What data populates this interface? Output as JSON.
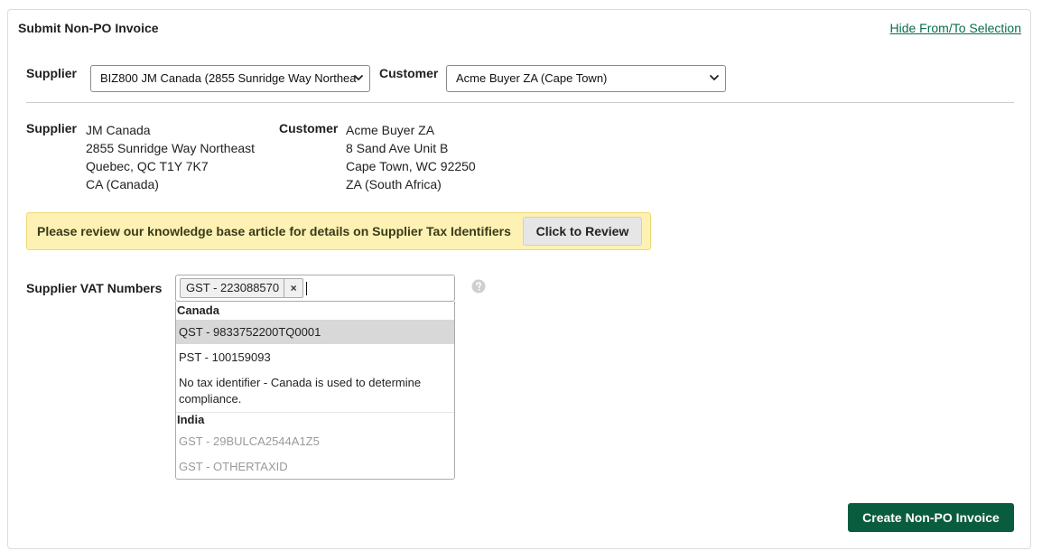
{
  "header": {
    "title": "Submit Non-PO Invoice",
    "hide_link": "Hide From/To Selection"
  },
  "selection": {
    "supplier_label": "Supplier",
    "supplier_value": "BIZ800 JM Canada (2855 Sunridge Way Northea",
    "customer_label": "Customer",
    "customer_value": "Acme Buyer ZA (Cape Town)"
  },
  "addresses": {
    "supplier": {
      "label": "Supplier",
      "lines": [
        "JM Canada",
        "2855 Sunridge Way Northeast",
        "Quebec, QC T1Y 7K7",
        "CA (Canada)"
      ]
    },
    "customer": {
      "label": "Customer",
      "lines": [
        "Acme Buyer ZA",
        "8 Sand Ave Unit B",
        "Cape Town, WC 92250",
        "ZA (South Africa)"
      ]
    }
  },
  "notice": {
    "text": "Please review our knowledge base article for details on Supplier Tax Identifiers",
    "button": "Click to Review"
  },
  "vat": {
    "label": "Supplier VAT Numbers",
    "selected_chip": "GST - 223088570",
    "chip_remove": "×",
    "groups": [
      {
        "name": "Canada",
        "options": [
          {
            "text": "QST - 9833752200TQ0001"
          },
          {
            "text": "PST - 100159093"
          },
          {
            "text": "No tax identifier - Canada is used to determine compliance."
          }
        ]
      },
      {
        "name": "India",
        "options": [
          {
            "text": "GST - 29BULCA2544A1Z5"
          },
          {
            "text": "GST - OTHERTAXID"
          }
        ]
      }
    ]
  },
  "footer": {
    "create_button": "Create Non-PO Invoice"
  },
  "colors": {
    "accent_green": "#0a5c3e",
    "link_green": "#0a6e4f",
    "notice_bg": "#fdf2b4",
    "highlight": "#d8d8d8"
  }
}
